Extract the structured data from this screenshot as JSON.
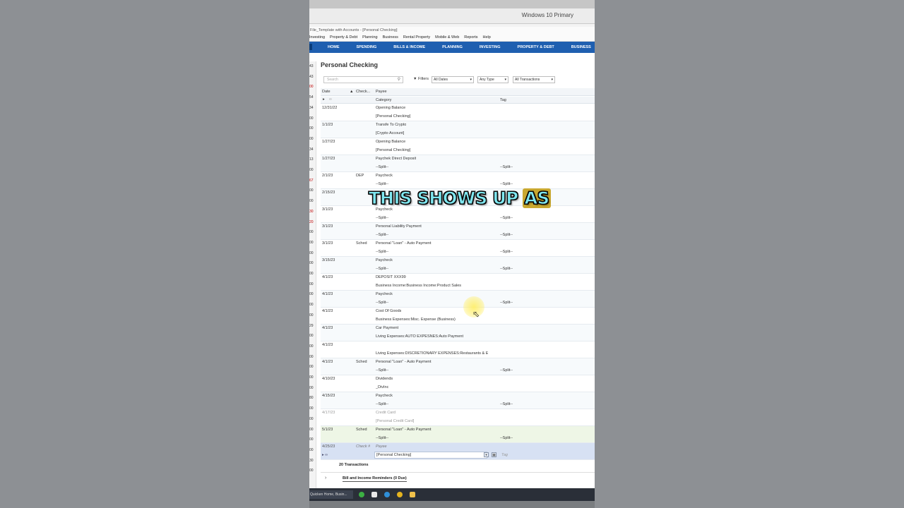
{
  "host": {
    "title": "Windows 10 Primary"
  },
  "app": {
    "window_title": "File_Template with Accounts - [Personal Checking]",
    "menu": [
      "Investing",
      "Property & Debt",
      "Planning",
      "Business",
      "Rental Property",
      "Mobile & Web",
      "Reports",
      "Help"
    ],
    "nav": [
      "HOME",
      "SPENDING",
      "BILLS & INCOME",
      "PLANNING",
      "INVESTING",
      "PROPERTY & DEBT",
      "BUSINESS",
      "R"
    ]
  },
  "left_strip": [
    "43",
    "43",
    "00",
    "54",
    "34",
    "00",
    "00",
    "00",
    "34",
    "13",
    "00",
    "67",
    "00",
    "00",
    "30",
    "20",
    "00",
    "00",
    "00",
    "00",
    "00",
    "00",
    "00",
    "00",
    "00",
    "29",
    "00",
    "00",
    "00",
    "00",
    "00",
    "00",
    "80",
    "00",
    "00",
    "00",
    "00",
    "00",
    "30",
    "00"
  ],
  "register": {
    "title": "Personal Checking",
    "search_placeholder": "Search",
    "filters_label": "Filters",
    "filter_dates": "All Dates",
    "filter_type": "Any Type",
    "filter_txn": "All Transactions",
    "columns": {
      "date": "Date",
      "check": "Check...",
      "payee": "Payee",
      "category": "Category",
      "tag": "Tag"
    },
    "transactions": [
      {
        "date": "12/31/22",
        "check": "",
        "payee": "Opening Balance",
        "category": "[Personal Checking]",
        "tag": ""
      },
      {
        "date": "1/1/23",
        "check": "",
        "payee": "Transfe To Crypto",
        "category": "[Crypto Account]",
        "tag": ""
      },
      {
        "date": "1/27/23",
        "check": "",
        "payee": "Opening Balance",
        "category": "[Personal Checking]",
        "tag": ""
      },
      {
        "date": "1/27/23",
        "check": "",
        "payee": "Paychek Direct Deposit",
        "category": "--Split--",
        "tag": "--Split--"
      },
      {
        "date": "2/1/23",
        "check": "DEP",
        "payee": "Paycheck",
        "category": "--Split--",
        "tag": "--Split--"
      },
      {
        "date": "2/15/23",
        "check": "",
        "payee": "",
        "category": "",
        "tag": ""
      },
      {
        "date": "3/1/23",
        "check": "",
        "payee": "Paycheck",
        "category": "--Split--",
        "tag": "--Split--"
      },
      {
        "date": "3/1/23",
        "check": "",
        "payee": "Personal Liability Payment",
        "category": "--Split--",
        "tag": "--Split--"
      },
      {
        "date": "3/1/23",
        "check": "Sched",
        "payee": "Personal \"Loan\" - Auto Payment",
        "category": "--Split--",
        "tag": "--Split--"
      },
      {
        "date": "3/15/23",
        "check": "",
        "payee": "Paycheck",
        "category": "--Split--",
        "tag": "--Split--"
      },
      {
        "date": "4/1/23",
        "check": "",
        "payee": "DEPOSIT XXX99",
        "category": "Business Income:Business Income:Product Sales",
        "tag": ""
      },
      {
        "date": "4/1/23",
        "check": "",
        "payee": "Paycheck",
        "category": "--Split--",
        "tag": "--Split--"
      },
      {
        "date": "4/1/23",
        "check": "",
        "payee": "Cost Of Goods",
        "category": "Business Expenses:Misc. Expense (Business)",
        "tag": ""
      },
      {
        "date": "4/1/23",
        "check": "",
        "payee": "Car Payment",
        "category": "Living Expenses:AUTO EXPESNES:Auto Payment",
        "tag": ""
      },
      {
        "date": "4/1/23",
        "check": "",
        "payee": "",
        "category": "Living Expenses:DISCRETIONARY EXPENSES:Restaurants & E",
        "tag": ""
      },
      {
        "date": "4/1/23",
        "check": "Sched",
        "payee": "Personal \"Loan\" - Auto Payment",
        "category": "--Split--",
        "tag": "--Split--"
      },
      {
        "date": "4/10/23",
        "check": "",
        "payee": "Dividends",
        "category": "_DivInc",
        "tag": ""
      },
      {
        "date": "4/15/23",
        "check": "",
        "payee": "Paycheck",
        "category": "--Split--",
        "tag": "--Split--"
      },
      {
        "date": "4/17/23",
        "check": "",
        "payee": "Credit Card",
        "category": "[Personal Credit Card]",
        "tag": ""
      },
      {
        "date": "5/1/23",
        "check": "Sched",
        "payee": "Personal \"Loan\" - Auto Payment",
        "category": "--Split--",
        "tag": "--Split--"
      }
    ],
    "new_row": {
      "date": "4/25/23",
      "check_ph": "Check #",
      "payee_ph": "Payee",
      "category": "[Personal Checking]",
      "tag_ph": "Tag"
    },
    "count_label": "20 Transactions",
    "reminders_label": "Bill and Income Reminders (0 Due)"
  },
  "taskbar": {
    "app_label": "Quicken Home, Busin..."
  },
  "caption": {
    "words": [
      "THIS SHOWS UP",
      "AS"
    ]
  },
  "colors": {
    "nav_blue": "#1f5fb0",
    "caption_cyan": "#7fe7f0",
    "caption_highlight": "#c9a830"
  }
}
